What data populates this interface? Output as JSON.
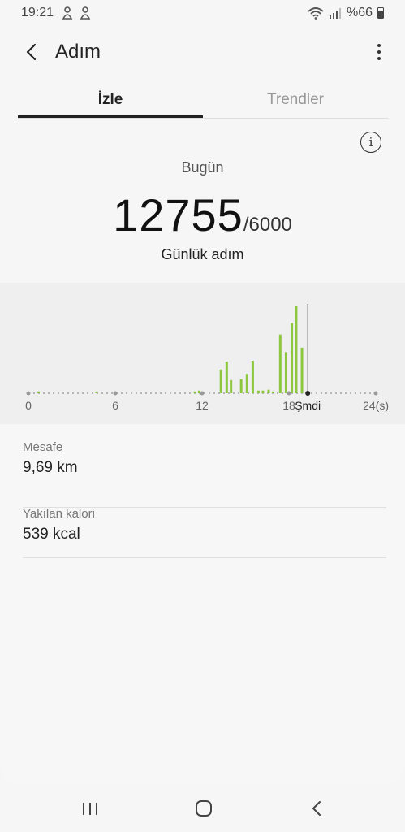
{
  "status_bar": {
    "time": "19:21",
    "battery": "%66",
    "icons": [
      "app-notification-icon",
      "app-notification-icon",
      "wifi-icon",
      "signal-icon",
      "battery-icon"
    ]
  },
  "app_bar": {
    "title": "Adım",
    "back_icon": "back-arrow-icon",
    "more_icon": "more-vertical-icon"
  },
  "tabs": [
    {
      "label": "İzle",
      "active": true
    },
    {
      "label": "Trendler",
      "active": false
    }
  ],
  "summary": {
    "date_label": "Bugün",
    "steps": "12755",
    "goal": "/6000",
    "caption": "Günlük adım"
  },
  "chart_data": {
    "type": "bar",
    "x_ticks": [
      "0",
      "6",
      "12",
      "18",
      "24(s)"
    ],
    "now_label": "Şmdi",
    "now_hour": 19.3,
    "x_range": [
      0,
      24
    ],
    "bar_color": "#8dc63f",
    "bars": [
      {
        "x": 0.7,
        "v": 0.02
      },
      {
        "x": 4.7,
        "v": 0.02
      },
      {
        "x": 11.5,
        "v": 0.02
      },
      {
        "x": 11.8,
        "v": 0.03
      },
      {
        "x": 13.3,
        "v": 0.27
      },
      {
        "x": 13.7,
        "v": 0.36
      },
      {
        "x": 14.0,
        "v": 0.15
      },
      {
        "x": 14.7,
        "v": 0.16
      },
      {
        "x": 15.1,
        "v": 0.22
      },
      {
        "x": 15.5,
        "v": 0.37
      },
      {
        "x": 15.9,
        "v": 0.03
      },
      {
        "x": 16.2,
        "v": 0.03
      },
      {
        "x": 16.6,
        "v": 0.04
      },
      {
        "x": 16.9,
        "v": 0.02
      },
      {
        "x": 17.4,
        "v": 0.67
      },
      {
        "x": 17.8,
        "v": 0.47
      },
      {
        "x": 18.2,
        "v": 0.8
      },
      {
        "x": 18.5,
        "v": 1.0
      },
      {
        "x": 18.9,
        "v": 0.52
      }
    ]
  },
  "stats": [
    {
      "label": "Mesafe",
      "value": "9,69 km"
    },
    {
      "label": "Yakılan kalori",
      "value": "539 kcal"
    }
  ],
  "nav_bar": {
    "icons": [
      "recent-apps-icon",
      "home-icon",
      "back-icon"
    ]
  }
}
